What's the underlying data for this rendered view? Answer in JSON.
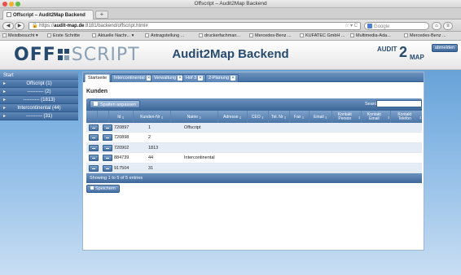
{
  "window": {
    "title": "Offscript – Audit2Map Backend"
  },
  "browser": {
    "tab_label": "Offscript – Audit2Map Backend",
    "new_tab": "+",
    "url_prefix": "https://",
    "url_domain": "audit-map.de",
    "url_rest": ":8181/backend/offscript.html#",
    "search_placeholder": "Google",
    "bookmarks": [
      "Meistbesucht ▾",
      "Erste Schritte",
      "Aktuelle Nachr... ▾",
      "Antragstellung ...",
      "druckerfachman...",
      "Mercedes-Benz ...",
      "KUFATEC GmbH ...",
      "Multimedia-Ada...",
      "Mercedes-Benz ..."
    ]
  },
  "header": {
    "logo_left": "OFF",
    "logo_right": "SCRIPT",
    "title": "Audit2Map Backend",
    "brand_a": "AUDIT",
    "brand_2": "2",
    "brand_map": "MAP",
    "logout": "abmelden"
  },
  "sidebar": {
    "head": "Start",
    "items": [
      {
        "label": "Offscript (1)"
      },
      {
        "label": "---------- (2)"
      },
      {
        "label": "---------- (1813)"
      },
      {
        "label": "Intercontinental (44)"
      },
      {
        "label": "---------- (31)"
      }
    ]
  },
  "tabs": [
    "Startseite",
    "Intercontinental",
    "Verwaltung",
    "Hof 3",
    "2-Planung"
  ],
  "main": {
    "section_title": "Kunden",
    "columns_button": "Spalten anpassen",
    "search_label": "Search:",
    "search_value": "",
    "columns": [
      "Id",
      "Kunden-Nr",
      "Name",
      "Adresse",
      "CEO",
      "Tel. Nr",
      "Fax",
      "Email",
      "Kontakt Person",
      "Kontakt Email",
      "Kontakt Telefon"
    ],
    "rows": [
      {
        "id": "720897",
        "nr": "1",
        "name": "Offscript"
      },
      {
        "id": "720898",
        "nr": "2",
        "name": ""
      },
      {
        "id": "720902",
        "nr": "1813",
        "name": ""
      },
      {
        "id": "884739",
        "nr": "44",
        "name": "Intercontinental"
      },
      {
        "id": "917504",
        "nr": "31",
        "name": ""
      }
    ],
    "footer_info": "Showing 1 to 5 of 5 entries",
    "save_button": "Speichern"
  }
}
